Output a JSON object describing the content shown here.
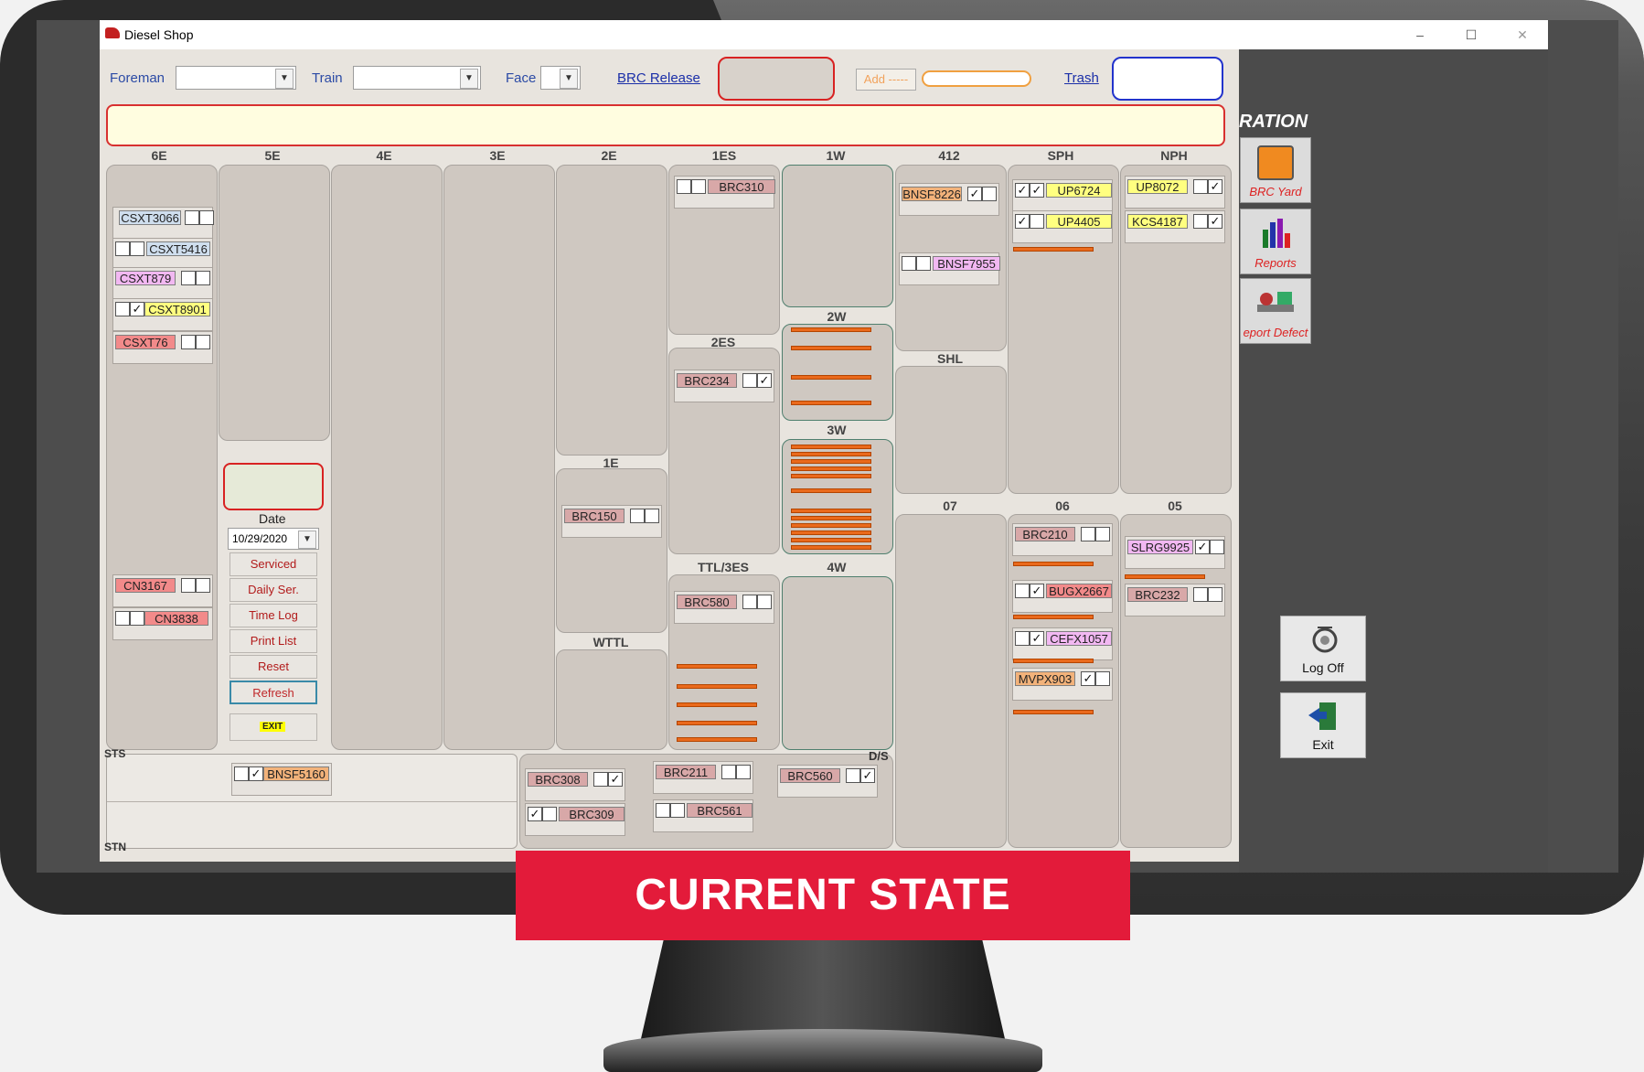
{
  "window": {
    "title": "Diesel Shop",
    "min": "–",
    "max": "☐",
    "close": "✕"
  },
  "toolbar": {
    "foreman_label": "Foreman",
    "train_label": "Train",
    "face_label": "Face",
    "brc_release": "BRC Release",
    "add_label": "Add -----",
    "trash": "Trash"
  },
  "columns": [
    "6E",
    "5E",
    "4E",
    "3E",
    "2E",
    "1ES",
    "1W",
    "412",
    "SPH",
    "NPH"
  ],
  "sub_labels": {
    "c2w": "2W",
    "c3w": "3W",
    "c4w": "4W",
    "c2es": "2ES",
    "c1e": "1E",
    "cttl": "TTL/3ES",
    "cwttl": "WTTL",
    "cshl": "SHL",
    "c07": "07",
    "c06": "06",
    "c05": "05",
    "sts": "STS",
    "stn": "STN",
    "ds": "D/S"
  },
  "cars": {
    "csxt3066": "CSXT3066",
    "csxt5416": "CSXT5416",
    "csxt879": "CSXT879",
    "csxt8901": "CSXT8901",
    "csxt76": "CSXT76",
    "cn3167": "CN3167",
    "cn3838": "CN3838",
    "brc310": "BRC310",
    "brc234": "BRC234",
    "brc150": "BRC150",
    "brc580": "BRC580",
    "bnsf8226": "BNSF8226",
    "bnsf7955": "BNSF7955",
    "up6724": "UP6724",
    "up4405": "UP4405",
    "up8072": "UP8072",
    "kcs4187": "KCS4187",
    "brc210": "BRC210",
    "bugx2667": "BUGX2667",
    "cefx1057": "CEFX1057",
    "mvpx903": "MVPX903",
    "slrg9925": "SLRG9925",
    "brc232": "BRC232",
    "bnsf5160": "BNSF5160",
    "brc308": "BRC308",
    "brc309": "BRC309",
    "brc211": "BRC211",
    "brc561": "BRC561",
    "brc560": "BRC560"
  },
  "side": {
    "date_label": "Date",
    "date_value": "10/29/2020",
    "serviced": "Serviced",
    "daily": "Daily Ser.",
    "timelog": "Time Log",
    "printlist": "Print List",
    "reset": "Reset",
    "refresh": "Refresh",
    "exit": "EXIT"
  },
  "right": {
    "heading": "RATION",
    "brc_yard": "BRC Yard",
    "reports": "Reports",
    "report_defect": "eport Defect",
    "logoff": "Log Off",
    "exit": "Exit"
  },
  "banner": "CURRENT STATE",
  "colors": {
    "orange": "#ea6a1c",
    "banner": "#e31b3a",
    "green_border": "#4f7f6e"
  }
}
